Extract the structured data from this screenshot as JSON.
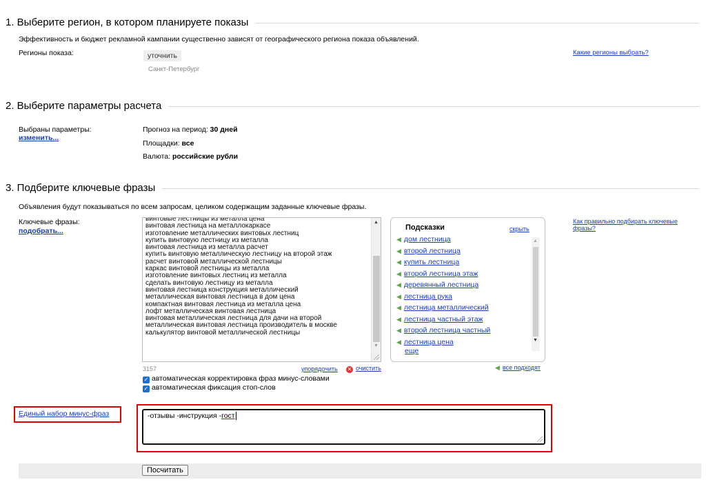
{
  "section1": {
    "title": "1. Выберите регион, в котором планируете показы",
    "description": "Эффективность и бюджет рекламной кампании существенно зависят от географического региона показа объявлений.",
    "regions_label": "Регионы показа:",
    "refine_button": "уточнить",
    "region_value": "Санкт-Петербург",
    "help_link": "Какие регионы выбрать?"
  },
  "section2": {
    "title": "2. Выберите параметры расчета",
    "params_label": "Выбраны параметры:",
    "change_link": "изменить...",
    "period_label": "Прогноз на период:",
    "period_value": "30 дней",
    "sites_label": "Площадки:",
    "sites_value": "все",
    "currency_label": "Валюта:",
    "currency_value": "российские рубли"
  },
  "section3": {
    "title": "3. Подберите ключевые фразы",
    "description": "Объявления будут показываться по всем запросам, целиком содержащим заданные ключевые фразы.",
    "keywords_label": "Ключевые фразы:",
    "pick_link": "подобрать...",
    "help_link": "Как правильно подбирать ключевые фразы?",
    "keywords": [
      "винтовые лестницы из металла цена",
      "винтовая лестница на металлокаркасе",
      "изготовление металлических винтовых лестниц",
      "купить винтовую лестницу из металла",
      "винтовая лестница из металла расчет",
      "купить винтовую металлическую лестницу на второй этаж",
      "расчет винтовой металлической лестницы",
      "каркас винтовой лестницы из металла",
      "изготовление винтовых лестниц из металла",
      "сделать винтовую лестницу из металла",
      "винтовая лестница конструкция металлический",
      "металлическая винтовая лестница в дом цена",
      "компактная винтовая лестница из металла цена",
      "лофт металлическая винтовая лестница",
      "винтовая металлическая лестница для дачи на второй",
      "металлическая винтовая лестница производитель в москве",
      "калькулятор винтовой металлической лестницы"
    ],
    "char_count": "3157",
    "sort_link": "упорядочить",
    "clear_link": "очистить",
    "auto_correct_label": "автоматическая корректировка фраз минус-словами",
    "auto_stop_label": "автоматическая фиксация стоп-слов",
    "hints": {
      "title": "Подсказки",
      "hide_link": "скрыть",
      "items": [
        "дом лестница",
        "второй лестница",
        "купить лестница",
        "второй лестница этаж",
        "деревянный лестница",
        "лестница рука",
        "лестница металлический",
        "лестница частный этаж",
        "второй лестница частный",
        "лестница цена"
      ],
      "more_link": "еще",
      "all_fit_link": "все подходят"
    }
  },
  "minus": {
    "label": "Единый набор минус-фраз",
    "value_prefix": "-отзывы -инструкция -",
    "value_underlined": "гост"
  },
  "submit": {
    "label": "Посчитать"
  },
  "colors": {
    "link": "#1a3dc1",
    "highlight_frame": "#e00000",
    "check": "#1c6fd1",
    "clear": "#e0332e",
    "hint_arrow": "#5aa84a"
  }
}
